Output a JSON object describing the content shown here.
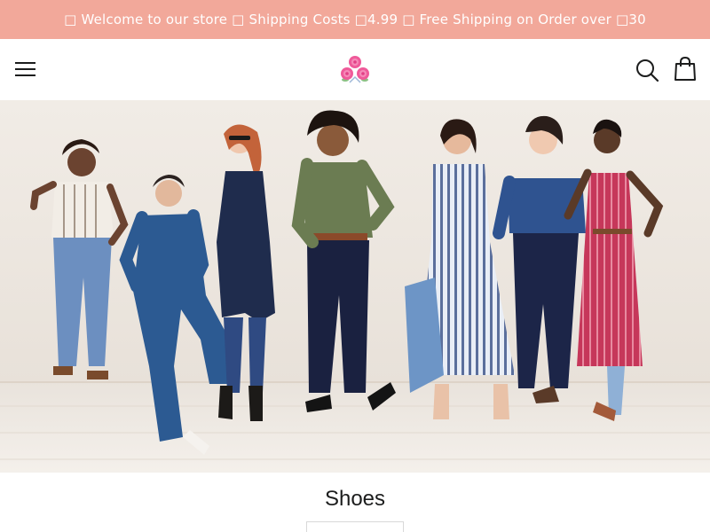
{
  "announcement": {
    "text": "□ Welcome to our store □ Shipping Costs □4.99 □ Free Shipping on Order over □30"
  },
  "header": {
    "menu_icon": "hamburger-menu-icon",
    "logo_icon": "rose-bouquet-logo",
    "search_icon": "search-icon",
    "cart_icon": "shopping-bag-icon"
  },
  "hero": {
    "image": "group-of-women-in-denim-and-striped-outfits"
  },
  "collection": {
    "title": "Shoes",
    "sort_value": ""
  },
  "colors": {
    "announcement_bg": "#f2a89a",
    "announcement_text": "#ffffff",
    "text": "#1c1d1d"
  }
}
